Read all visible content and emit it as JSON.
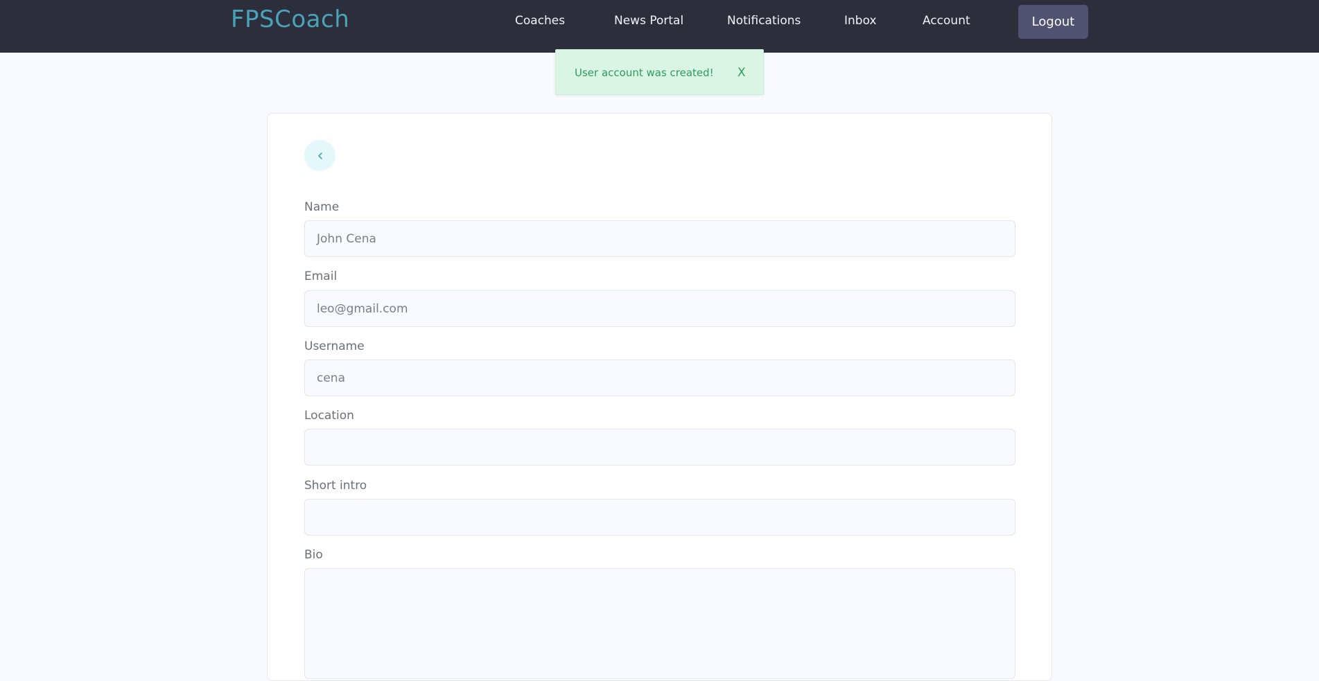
{
  "header": {
    "logo": "FPSCoach",
    "nav": [
      "Coaches",
      "News Portal",
      "Notifications",
      "Inbox",
      "Account"
    ],
    "logout_label": "Logout"
  },
  "alert": {
    "message": "User account was created!",
    "close_label": "X"
  },
  "form": {
    "back_icon": "chevron-left-icon",
    "fields": [
      {
        "label": "Name",
        "value": "John Cena"
      },
      {
        "label": "Email",
        "value": "leo@gmail.com"
      },
      {
        "label": "Username",
        "value": "cena"
      },
      {
        "label": "Location",
        "value": ""
      },
      {
        "label": "Short intro",
        "value": ""
      },
      {
        "label": "Bio",
        "value": ""
      }
    ]
  },
  "colors": {
    "header_bg": "#2c2e3c",
    "brand": "#4aa3b8",
    "logout_bg": "#4f5270",
    "success_bg": "#daf5e4",
    "success_text": "#2f9a5f"
  }
}
